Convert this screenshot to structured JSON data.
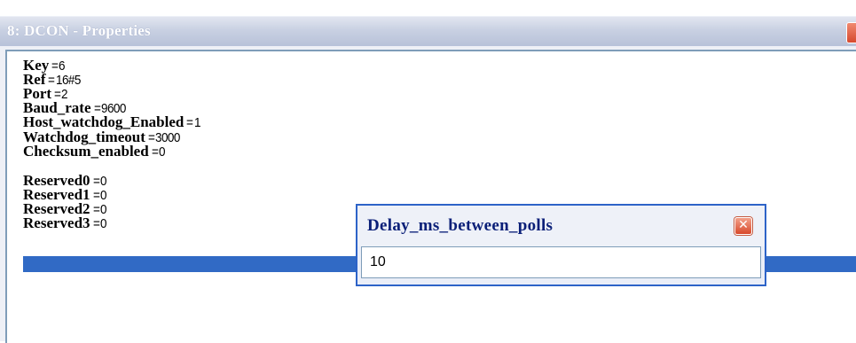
{
  "window": {
    "title": "8: DCON - Properties",
    "close_icon": "close-icon"
  },
  "properties": [
    {
      "key": "Key",
      "value": "6"
    },
    {
      "key": "Ref",
      "value": "16#5"
    },
    {
      "key": "Port",
      "value": "2"
    },
    {
      "key": "Baud_rate",
      "value": "9600"
    },
    {
      "key": "Host_watchdog_Enabled",
      "value": "1"
    },
    {
      "key": "Watchdog_timeout",
      "value": "3000"
    },
    {
      "key": "Checksum_enabled",
      "value": "0"
    },
    {
      "key": "Delay_ms_between_polls",
      "value": "10"
    },
    {
      "key": "Reserved0",
      "value": "0"
    },
    {
      "key": "Reserved1",
      "value": "0"
    },
    {
      "key": "Reserved2",
      "value": "0"
    },
    {
      "key": "Reserved3",
      "value": "0"
    }
  ],
  "equals": "=",
  "selected_index": 7,
  "dialog": {
    "title": "Delay_ms_between_polls",
    "value": "10",
    "close_glyph": "✕"
  },
  "colors": {
    "selection": "#316ac5",
    "dialog_border": "#2d63c8",
    "dialog_title_text": "#0a1f78"
  }
}
